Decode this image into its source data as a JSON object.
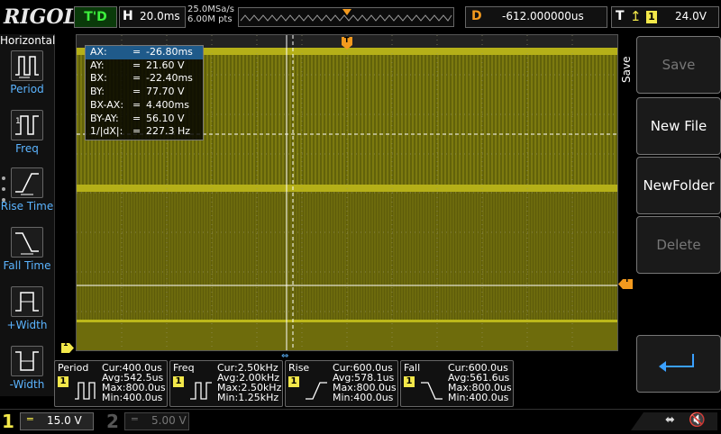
{
  "header": {
    "logo": "RIGOL",
    "run_status": "T'D",
    "horizontal_label": "H",
    "timebase": "20.0ms",
    "sample_rate": "25.0MSa/s",
    "memory_depth": "6.00M pts",
    "delay_label": "D",
    "delay_value": "-612.000000us",
    "trigger_label": "T",
    "trigger_source": "1",
    "trigger_level": "24.0V"
  },
  "left_menu": {
    "title": "Horizontal",
    "items": [
      {
        "label": "Period",
        "icon": "period-icon"
      },
      {
        "label": "Freq",
        "icon": "freq-icon"
      },
      {
        "label": "Rise Time",
        "icon": "rise-time-icon"
      },
      {
        "label": "Fall Time",
        "icon": "fall-time-icon"
      },
      {
        "label": "+Width",
        "icon": "pos-width-icon"
      },
      {
        "label": "-Width",
        "icon": "neg-width-icon"
      }
    ]
  },
  "cursor_table": {
    "rows": [
      {
        "key": "AX:",
        "value": "-26.80ms"
      },
      {
        "key": "AY:",
        "value": "21.60 V"
      },
      {
        "key": "BX:",
        "value": "-22.40ms"
      },
      {
        "key": "BY:",
        "value": "77.70 V"
      },
      {
        "key": "BX-AX:",
        "value": "4.400ms"
      },
      {
        "key": "BY-AY:",
        "value": "56.10 V"
      },
      {
        "key": "1/|dX|:",
        "value": "227.3 Hz"
      }
    ]
  },
  "right_menu": {
    "title": "Save",
    "buttons": [
      {
        "label": "Save",
        "enabled": false
      },
      {
        "label": "New File",
        "enabled": true
      },
      {
        "label": "NewFolder",
        "enabled": true
      },
      {
        "label": "Delete",
        "enabled": false
      }
    ]
  },
  "markers": {
    "trigger_pos": "T",
    "trigger_level": "T",
    "ch1_ground": "1"
  },
  "measurements": [
    {
      "title": "Period",
      "channel": "1",
      "lines": [
        "Cur:400.0us",
        "Avg:542.5us",
        "Max:800.0us",
        "Min:400.0us"
      ]
    },
    {
      "title": "Freq",
      "channel": "1",
      "lines": [
        "Cur:2.50kHz",
        "Avg:2.00kHz",
        "Max:2.50kHz",
        "Min:1.25kHz"
      ]
    },
    {
      "title": "Rise",
      "channel": "1",
      "lines": [
        "Cur:600.0us",
        "Avg:578.1us",
        "Max:800.0us",
        "Min:400.0us"
      ]
    },
    {
      "title": "Fall",
      "channel": "1",
      "lines": [
        "Cur:600.0us",
        "Avg:561.6us",
        "Max:800.0us",
        "Min:400.0us"
      ]
    }
  ],
  "channels": {
    "ch1": {
      "label": "1",
      "scale": "15.0 V",
      "color": "#f3e84a"
    },
    "ch2": {
      "label": "2",
      "scale": "5.00 V"
    }
  },
  "colors": {
    "trace": "#c8c21a",
    "accent": "#f39a1e",
    "selected": "#1f5a8a"
  }
}
